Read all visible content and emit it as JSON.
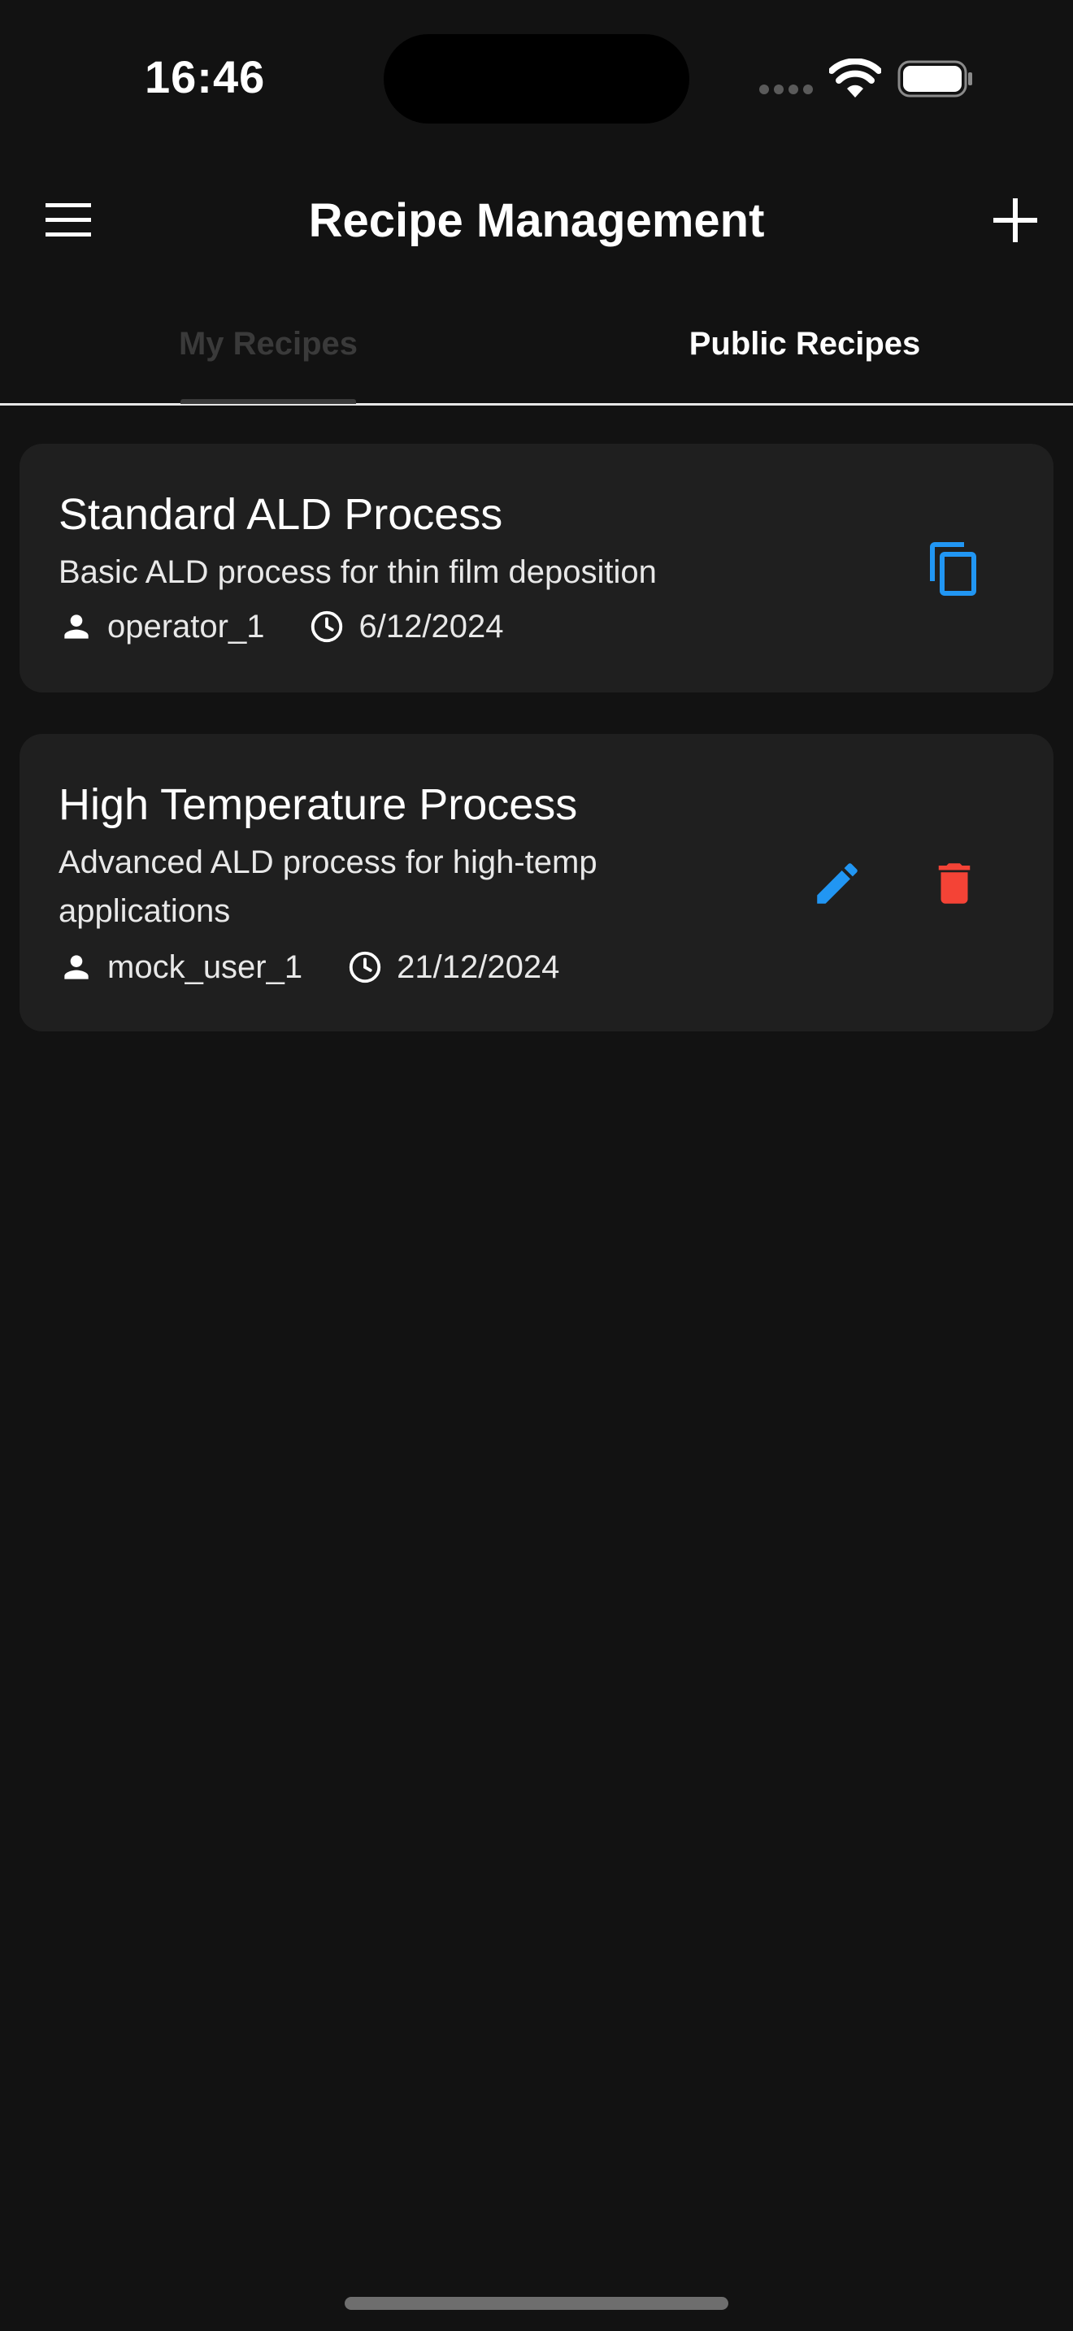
{
  "status_bar": {
    "time": "16:46"
  },
  "app_bar": {
    "title": "Recipe Management",
    "menu_icon": "menu-icon",
    "add_icon": "add-icon"
  },
  "tabs": [
    {
      "label": "My Recipes",
      "selected": true
    },
    {
      "label": "Public Recipes",
      "selected": false
    }
  ],
  "recipes": [
    {
      "title": "Standard ALD Process",
      "description": "Basic ALD process for thin film deposition",
      "author": "operator_1",
      "date": "6/12/2024",
      "actions": [
        "copy-icon"
      ]
    },
    {
      "title": "High Temperature Process",
      "description": "Advanced ALD process for high-temp applications",
      "author": "mock_user_1",
      "date": "21/12/2024",
      "actions": [
        "edit-icon",
        "delete-icon"
      ]
    }
  ],
  "colors": {
    "background": "#121212",
    "card": "#1f1f1f",
    "accent_blue": "#2196f3",
    "delete_red": "#f44336",
    "tab_inactive": "#3a3a3a"
  }
}
